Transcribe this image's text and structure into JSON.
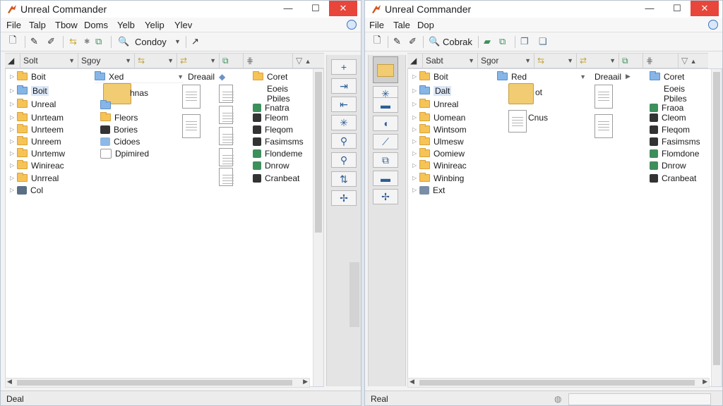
{
  "left": {
    "title": "Unreal Commander",
    "menu": [
      "File",
      "Talp",
      "Tbow",
      "Doms",
      "Yelb",
      "Yelip",
      "Ylev"
    ],
    "toolbar": {
      "dropdown": "Condoy"
    },
    "header": [
      "Solt",
      "Sgoy"
    ],
    "tree": [
      {
        "label": "Boit",
        "selected": false,
        "folder": "yellow"
      },
      {
        "label": "Boit",
        "selected": true,
        "folder": "blue"
      },
      {
        "label": "Unreal",
        "selected": false,
        "folder": "yellow"
      },
      {
        "label": "Unrteam",
        "selected": false,
        "folder": "yellow"
      },
      {
        "label": "Unrteem",
        "selected": false,
        "folder": "yellow"
      },
      {
        "label": "Unreem",
        "selected": false,
        "folder": "yellow"
      },
      {
        "label": "Unrtemw",
        "selected": false,
        "folder": "yellow"
      },
      {
        "label": "Winireac",
        "selected": false,
        "folder": "yellow"
      },
      {
        "label": "Unrreal",
        "selected": false,
        "folder": "yellow"
      },
      {
        "label": "Col",
        "selected": false,
        "folder": "drive"
      }
    ],
    "col2": {
      "header": "Xed",
      "big_folder_label": "hnas",
      "items": [
        "Fleors",
        "Bories",
        "Cidoes",
        "Dpimired"
      ]
    },
    "col3": {
      "header": "Dreaail"
    },
    "col4": {
      "items": [
        "Coret",
        "Eoeis",
        "Pbiles",
        "Fnatra",
        "Fleom",
        "Fleqom",
        "Fasimsms",
        "Flondeme",
        "Dnrow",
        "Cranbeat"
      ]
    },
    "status": "Deal"
  },
  "right": {
    "title": "Unreal Commander",
    "menu": [
      "File",
      "Tale",
      "Dop"
    ],
    "toolbar": {
      "dropdown": "Cobrak"
    },
    "header": [
      "Sabt",
      "Sgor"
    ],
    "tree": [
      {
        "label": "Boit",
        "selected": false,
        "folder": "yellow"
      },
      {
        "label": "Dalt",
        "selected": true,
        "folder": "blue"
      },
      {
        "label": "Unreal",
        "selected": false,
        "folder": "yellow"
      },
      {
        "label": "Uomean",
        "selected": false,
        "folder": "yellow"
      },
      {
        "label": "Wintsom",
        "selected": false,
        "folder": "yellow"
      },
      {
        "label": "Ulmesw",
        "selected": false,
        "folder": "yellow"
      },
      {
        "label": "Oomiew",
        "selected": false,
        "folder": "yellow"
      },
      {
        "label": "Winireac",
        "selected": false,
        "folder": "yellow"
      },
      {
        "label": "Winbing",
        "selected": false,
        "folder": "yellow"
      },
      {
        "label": "Ext",
        "selected": false,
        "folder": "drive"
      }
    ],
    "col2": {
      "header": "Red",
      "big_folder_label": "ot",
      "items": [
        "Cnus"
      ]
    },
    "col3": {
      "header": "Dreaail"
    },
    "col4": {
      "items": [
        "Coret",
        "Eoeis",
        "Pbiles",
        "Fraoa",
        "Cleom",
        "Fleqom",
        "Fasimsms",
        "Flomdone",
        "Dnrow",
        "Cranbeat"
      ]
    },
    "status": "Real"
  }
}
